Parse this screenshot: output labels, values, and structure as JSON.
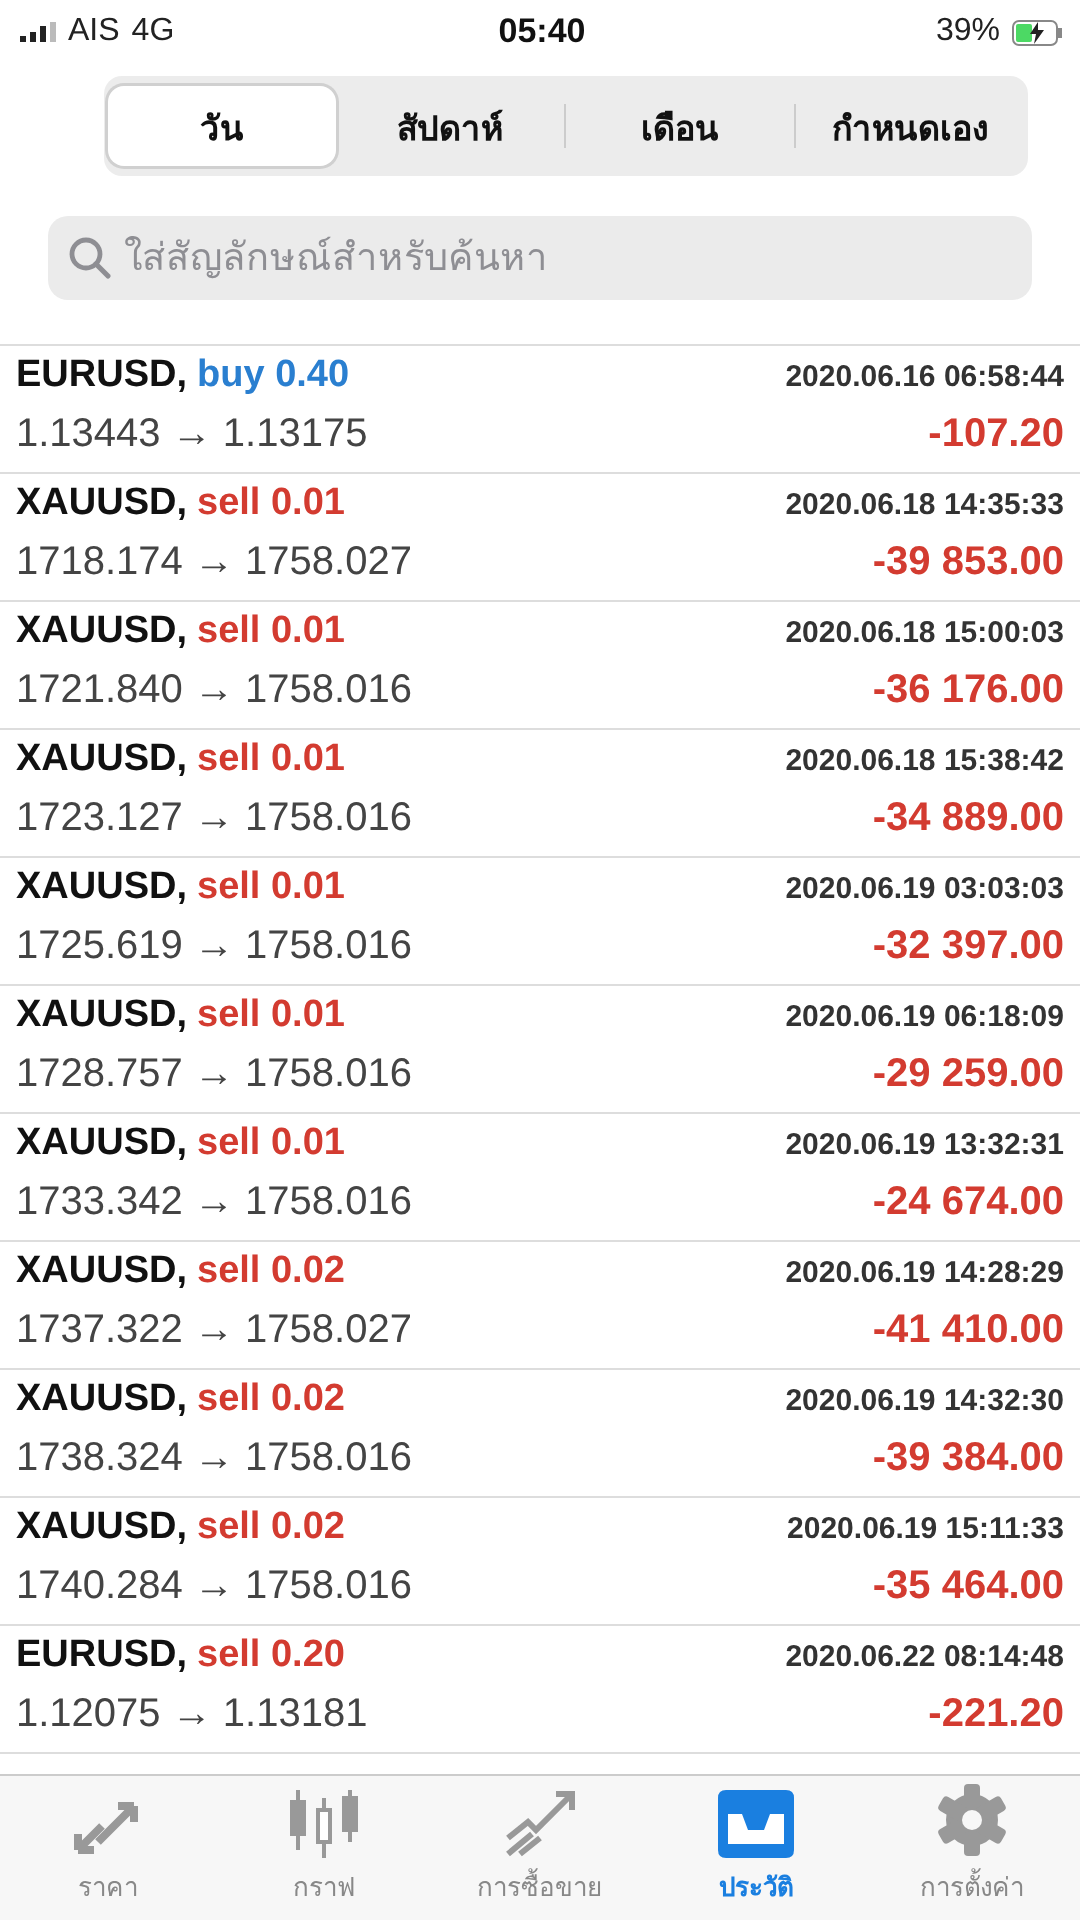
{
  "status_bar": {
    "carrier": "AIS",
    "network": "4G",
    "time": "05:40",
    "battery": "39%",
    "charging": true
  },
  "tabs": [
    {
      "label": "วัน",
      "selected": true
    },
    {
      "label": "สัปดาห์",
      "selected": false
    },
    {
      "label": "เดือน",
      "selected": false
    },
    {
      "label": "กำหนดเอง",
      "selected": false
    }
  ],
  "search": {
    "placeholder": "ใส่สัญลักษณ์สำหรับค้นหา"
  },
  "trades": [
    {
      "symbol": "EURUSD,",
      "side": "buy",
      "lots": "0.40",
      "prices": "1.13443 → 1.13175",
      "time": "2020.06.16 06:58:44",
      "profit": "-107.20"
    },
    {
      "symbol": "XAUUSD,",
      "side": "sell",
      "lots": "0.01",
      "prices": "1718.174 → 1758.027",
      "time": "2020.06.18 14:35:33",
      "profit": "-39 853.00"
    },
    {
      "symbol": "XAUUSD,",
      "side": "sell",
      "lots": "0.01",
      "prices": "1721.840 → 1758.016",
      "time": "2020.06.18 15:00:03",
      "profit": "-36 176.00"
    },
    {
      "symbol": "XAUUSD,",
      "side": "sell",
      "lots": "0.01",
      "prices": "1723.127 → 1758.016",
      "time": "2020.06.18 15:38:42",
      "profit": "-34 889.00"
    },
    {
      "symbol": "XAUUSD,",
      "side": "sell",
      "lots": "0.01",
      "prices": "1725.619 → 1758.016",
      "time": "2020.06.19 03:03:03",
      "profit": "-32 397.00"
    },
    {
      "symbol": "XAUUSD,",
      "side": "sell",
      "lots": "0.01",
      "prices": "1728.757 → 1758.016",
      "time": "2020.06.19 06:18:09",
      "profit": "-29 259.00"
    },
    {
      "symbol": "XAUUSD,",
      "side": "sell",
      "lots": "0.01",
      "prices": "1733.342 → 1758.016",
      "time": "2020.06.19 13:32:31",
      "profit": "-24 674.00"
    },
    {
      "symbol": "XAUUSD,",
      "side": "sell",
      "lots": "0.02",
      "prices": "1737.322 → 1758.027",
      "time": "2020.06.19 14:28:29",
      "profit": "-41 410.00"
    },
    {
      "symbol": "XAUUSD,",
      "side": "sell",
      "lots": "0.02",
      "prices": "1738.324 → 1758.016",
      "time": "2020.06.19 14:32:30",
      "profit": "-39 384.00"
    },
    {
      "symbol": "XAUUSD,",
      "side": "sell",
      "lots": "0.02",
      "prices": "1740.284 → 1758.016",
      "time": "2020.06.19 15:11:33",
      "profit": "-35 464.00"
    },
    {
      "symbol": "EURUSD,",
      "side": "sell",
      "lots": "0.20",
      "prices": "1.12075 → 1.13181",
      "time": "2020.06.22 08:14:48",
      "profit": "-221.20"
    }
  ],
  "nav": [
    {
      "kind": "quotes",
      "label": "ราคา",
      "selected": false
    },
    {
      "kind": "chart",
      "label": "กราฟ",
      "selected": false
    },
    {
      "kind": "trade",
      "label": "การซื้อขาย",
      "selected": false
    },
    {
      "kind": "history",
      "label": "ประวัติ",
      "selected": true
    },
    {
      "kind": "settings",
      "label": "การตั้งค่า",
      "selected": false
    }
  ]
}
